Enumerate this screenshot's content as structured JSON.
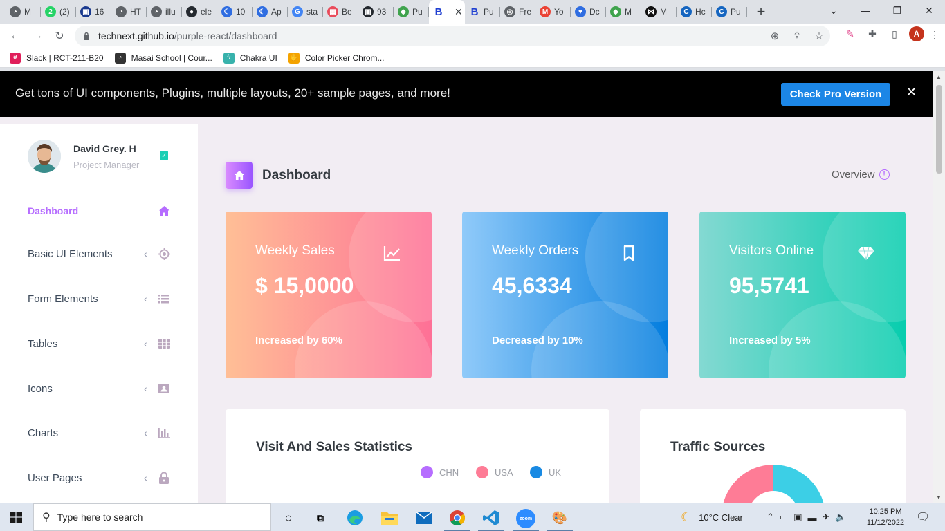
{
  "browser": {
    "tabs": [
      {
        "label": "M",
        "color": "#5f6368",
        "glyph": "◔"
      },
      {
        "label": "(2)",
        "color": "#25d366",
        "glyph": "2"
      },
      {
        "label": "16",
        "color": "#1a3a8f",
        "glyph": "▣"
      },
      {
        "label": "HT",
        "color": "#5f6368",
        "glyph": "◔"
      },
      {
        "label": "illu",
        "color": "#5f6368",
        "glyph": "◔"
      },
      {
        "label": "ele",
        "color": "#24292f",
        "glyph": "●"
      },
      {
        "label": "10",
        "color": "#2f6de1",
        "glyph": "☾"
      },
      {
        "label": "Ap",
        "color": "#2f6de1",
        "glyph": "☾"
      },
      {
        "label": "sta",
        "color": "#4285f4",
        "glyph": "G"
      },
      {
        "label": "Be",
        "color": "#e94b5b",
        "glyph": "▦"
      },
      {
        "label": "93",
        "color": "#24292f",
        "glyph": "▣"
      },
      {
        "label": "Pu",
        "color": "#3fa34d",
        "glyph": "◆"
      },
      {
        "label": "",
        "color": "#1f3fd1",
        "glyph": "B",
        "active": true
      },
      {
        "label": "Pu",
        "color": "#1f3fd1",
        "glyph": "B"
      },
      {
        "label": "Fre",
        "color": "#5f6368",
        "glyph": "◎"
      },
      {
        "label": "Yo",
        "color": "#ea4335",
        "glyph": "M"
      },
      {
        "label": "Dc",
        "color": "#2f6de1",
        "glyph": "♥"
      },
      {
        "label": "M",
        "color": "#3fa34d",
        "glyph": "◆"
      },
      {
        "label": "M",
        "color": "#111111",
        "glyph": "⋈"
      },
      {
        "label": "Hc",
        "color": "#1565c0",
        "glyph": "C"
      },
      {
        "label": "Pu",
        "color": "#1565c0",
        "glyph": "C"
      }
    ],
    "url_host": "technext.github.io",
    "url_path": "/purple-react/dashboard",
    "profile_initial": "A",
    "bookmarks": [
      {
        "label": "Slack | RCT-211-B20",
        "color": "#e01e5a",
        "glyph": "#"
      },
      {
        "label": "Masai School | Cour...",
        "color": "#333333",
        "glyph": "◔"
      },
      {
        "label": "Chakra UI",
        "color": "#38b2ac",
        "glyph": "ϟ"
      },
      {
        "label": "Color Picker Chrom...",
        "color": "#f4a300",
        "glyph": "✋"
      }
    ]
  },
  "promo": {
    "text": "Get tons of UI components, Plugins, multiple layouts, 20+ sample pages, and more!",
    "button": "Check Pro Version",
    "close": "✕"
  },
  "sidebar": {
    "name": "David Grey. H",
    "role": "Project Manager",
    "items": [
      {
        "label": "Dashboard",
        "icon": "home-icon"
      },
      {
        "label": "Basic UI Elements",
        "icon": "crosshair-icon"
      },
      {
        "label": "Form Elements",
        "icon": "list-icon"
      },
      {
        "label": "Tables",
        "icon": "table-icon"
      },
      {
        "label": "Icons",
        "icon": "contacts-icon"
      },
      {
        "label": "Charts",
        "icon": "chart-bar-icon"
      },
      {
        "label": "User Pages",
        "icon": "lock-icon"
      }
    ]
  },
  "page": {
    "title": "Dashboard",
    "overview": "Overview",
    "info": "!"
  },
  "cards": [
    {
      "title": "Weekly Sales",
      "value": "$ 15,0000",
      "sub": "Increased by 60%",
      "icon": "chart-line-icon",
      "theme": "danger"
    },
    {
      "title": "Weekly Orders",
      "value": "45,6334",
      "sub": "Decreased by 10%",
      "icon": "bookmark-icon",
      "theme": "info"
    },
    {
      "title": "Visitors Online",
      "value": "95,5741",
      "sub": "Increased by 5%",
      "icon": "diamond-icon",
      "theme": "success"
    }
  ],
  "panels": {
    "visit_title": "Visit And Sales Statistics",
    "legend": [
      {
        "label": "CHN",
        "color": "#b66dff"
      },
      {
        "label": "USA",
        "color": "#fe7c96"
      },
      {
        "label": "UK",
        "color": "#198ae3"
      }
    ],
    "traffic_title": "Traffic Sources"
  },
  "taskbar": {
    "search_placeholder": "Type here to search",
    "weather": "10°C  Clear",
    "time": "10:25 PM",
    "date": "11/12/2022",
    "zoom_label": "zoom"
  },
  "colors": {
    "accent": "#b66dff",
    "promo_button": "#1c86e6"
  }
}
